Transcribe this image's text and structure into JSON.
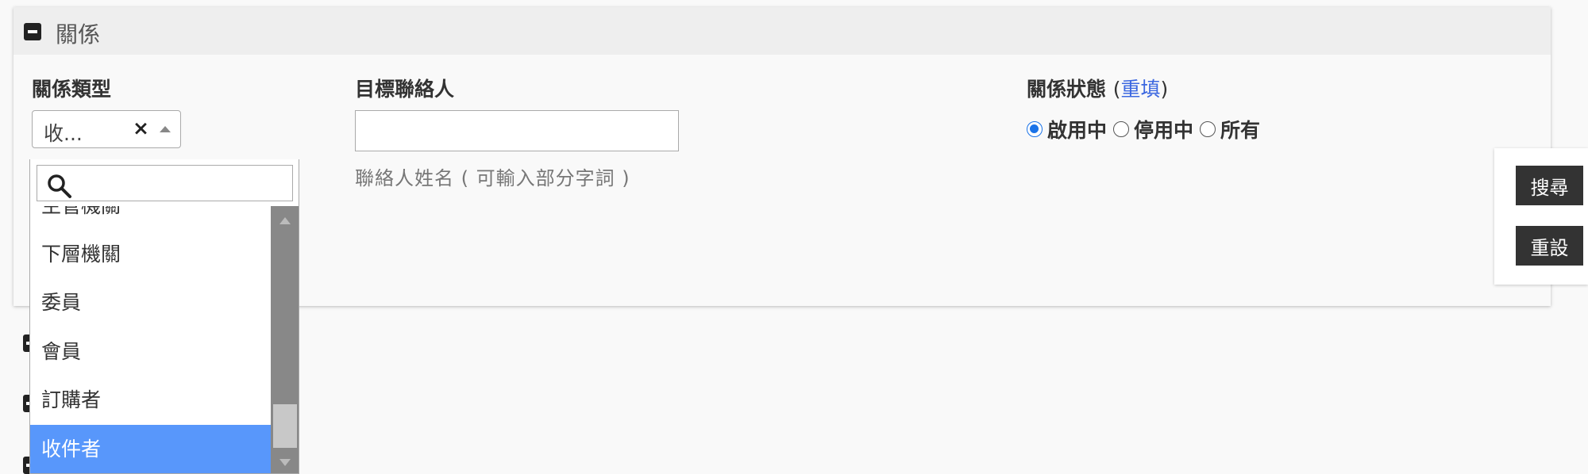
{
  "panel": {
    "title": "關係"
  },
  "relation_type": {
    "label": "關係類型",
    "selected_display": "收...",
    "clear_glyph": "×"
  },
  "target_contact": {
    "label": "目標聯絡人",
    "value": "",
    "hint": "聯絡人姓名 ( 可輸入部分字詞 )"
  },
  "relation_status": {
    "label": "關係狀態",
    "reset_link": "重填",
    "options": [
      {
        "label": "啟用中",
        "checked": true
      },
      {
        "label": "停用中",
        "checked": false
      },
      {
        "label": "所有",
        "checked": false
      }
    ]
  },
  "dropdown": {
    "search_value": "",
    "items": [
      "主管機關",
      "下層機關",
      "委員",
      "會員",
      "訂購者",
      "收件者"
    ],
    "selected": "收件者"
  },
  "actions": {
    "search_label": "搜尋",
    "reset_label": "重設"
  },
  "colors": {
    "accent": "#5897fb",
    "link": "#3b67e0",
    "button_bg": "#333333",
    "header_bg": "#eeeeee"
  }
}
